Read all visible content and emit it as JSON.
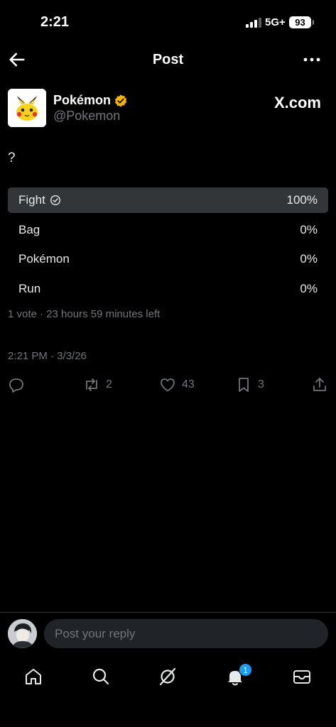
{
  "status_bar": {
    "time": "2:21",
    "network": "5G+",
    "battery": "93"
  },
  "header": {
    "title": "Post",
    "back_icon": "arrow-left-icon",
    "more_icon": "more-horizontal-icon"
  },
  "author": {
    "name": "Pokémon",
    "handle": "@Pokemon",
    "verified_color": "#f4b400",
    "avatar_icon": "pikachu-avatar"
  },
  "source_label": "X.com",
  "post": {
    "text": "?"
  },
  "poll": {
    "options": [
      {
        "label": "Fight",
        "percent": "100%",
        "fraction": 1.0,
        "winner": true
      },
      {
        "label": "Bag",
        "percent": "0%",
        "fraction": 0.0,
        "winner": false
      },
      {
        "label": "Pokémon",
        "percent": "0%",
        "fraction": 0.0,
        "winner": false
      },
      {
        "label": "Run",
        "percent": "0%",
        "fraction": 0.0,
        "winner": false
      }
    ],
    "meta": "1 vote · 23 hours 59 minutes left"
  },
  "timestamp": "2:21 PM · 3/3/26",
  "actions": {
    "reply_icon": "reply-icon",
    "repost_count": "2",
    "like_count": "43",
    "bookmark_count": "3",
    "share_icon": "share-icon"
  },
  "reply": {
    "placeholder": "Post your reply"
  },
  "tabbar": {
    "items": [
      "home-icon",
      "search-icon",
      "grok-icon",
      "notifications-icon",
      "messages-icon"
    ],
    "notification_badge": "1",
    "accent": "#1d9bf0"
  }
}
